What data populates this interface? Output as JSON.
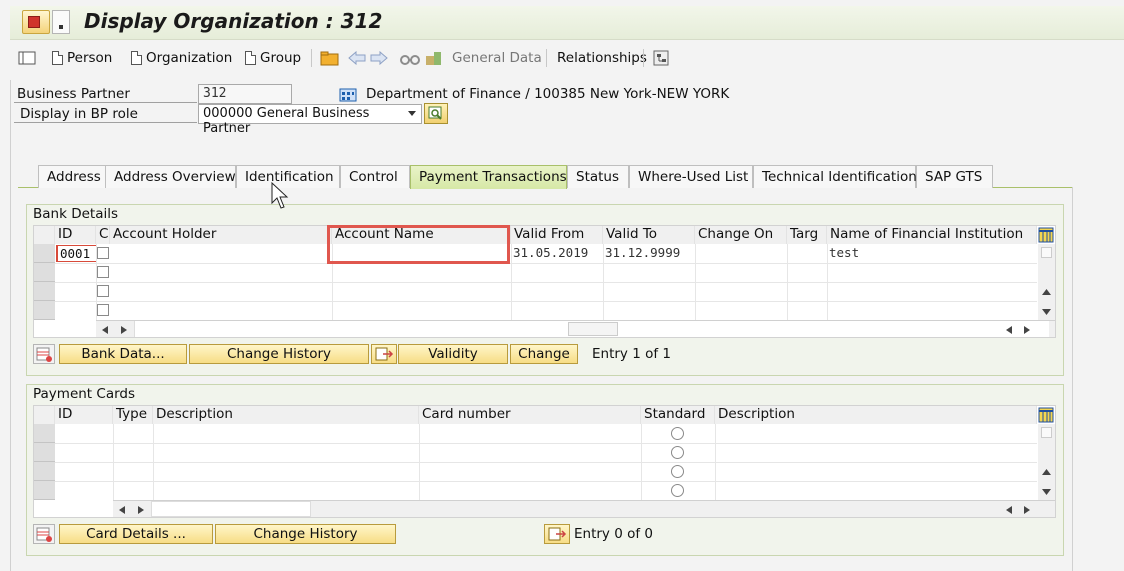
{
  "window": {
    "title": "Display Organization : 312"
  },
  "toolbar": {
    "person": "Person",
    "organization": "Organization",
    "group": "Group",
    "general_data": "General Data",
    "relationships": "Relationships"
  },
  "header": {
    "bp_label": "Business Partner",
    "bp_value": "312",
    "bp_description": "Department of Finance / 100385 New York-NEW YORK",
    "role_label": "Display in BP role",
    "role_value": "000000 General Business Partner"
  },
  "tabs": [
    {
      "label": "Address"
    },
    {
      "label": "Address Overview"
    },
    {
      "label": "Identification"
    },
    {
      "label": "Control"
    },
    {
      "label": "Payment Transactions",
      "active": true
    },
    {
      "label": "Status"
    },
    {
      "label": "Where-Used List"
    },
    {
      "label": "Technical Identification"
    },
    {
      "label": "SAP GTS"
    }
  ],
  "bank_details": {
    "title": "Bank Details",
    "columns": [
      "ID",
      "C",
      "Account Holder",
      "Account Name",
      "Valid From",
      "Valid To",
      "Change On",
      "Targ",
      "Name of Financial Institution"
    ],
    "rows": [
      {
        "id": "0001",
        "valid_from": "31.05.2019",
        "valid_to": "31.12.9999",
        "institution": "test"
      }
    ],
    "buttons": {
      "bank_data": "Bank Data...",
      "change_history": "Change History",
      "validity": "Validity",
      "change": "Change"
    },
    "entry_status": "Entry 1 of 1"
  },
  "payment_cards": {
    "title": "Payment Cards",
    "columns": [
      "ID",
      "Type",
      "Description",
      "Card number",
      "Standard",
      "Description"
    ],
    "buttons": {
      "card_details": "Card Details ...",
      "change_history": "Change History"
    },
    "entry_status": "Entry 0 of 0"
  }
}
